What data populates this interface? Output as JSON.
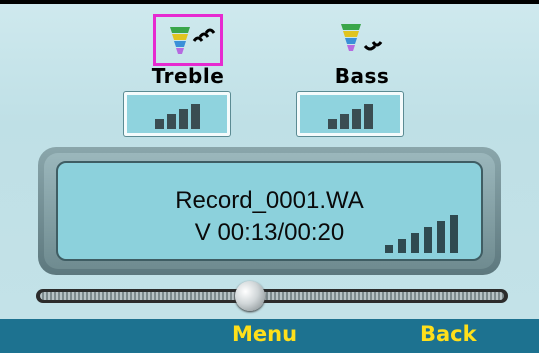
{
  "tone_controls": [
    {
      "label": "Treble",
      "icon": "treble-tone-icon",
      "selected": true,
      "level_bars": 4
    },
    {
      "label": "Bass",
      "icon": "bass-tone-icon",
      "selected": false,
      "level_bars": 4
    }
  ],
  "display": {
    "filename": "Record_0001.WA",
    "time": "V 00:13/00:20",
    "volume_bars": 6
  },
  "progress": {
    "fraction": 0.45
  },
  "softkeys": {
    "left": "Menu",
    "right": "Back"
  },
  "colors": {
    "softkey_text": "#ffdf1a",
    "softbar_bg": "#1d7290",
    "selection_border": "#e62ad0",
    "lcd_bg": "#8cd1dc"
  }
}
